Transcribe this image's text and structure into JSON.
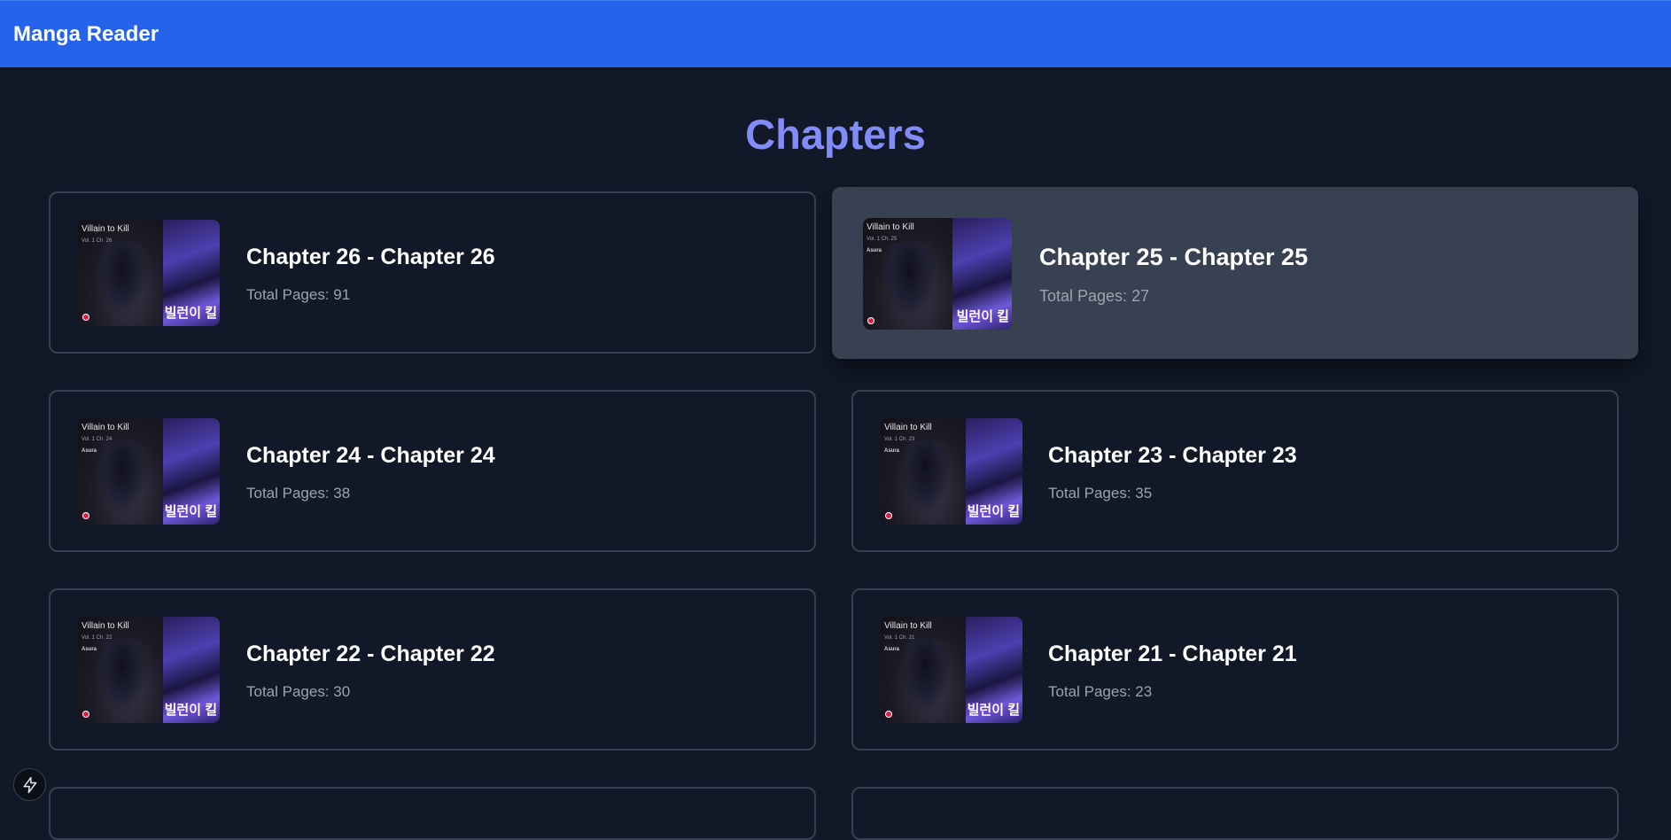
{
  "app": {
    "title": "Manga Reader"
  },
  "main": {
    "heading": "Chapters"
  },
  "thumbnail": {
    "title": "Villain to Kill",
    "author": "Asura",
    "korean": "빌런이 킬"
  },
  "chapters": [
    {
      "title": "Chapter 26 - Chapter 26",
      "pages": "Total Pages: 91",
      "vol": "Vol. 1 Ch. 26"
    },
    {
      "title": "Chapter 25 - Chapter 25",
      "pages": "Total Pages: 27",
      "vol": "Vol. 1 Ch. 25"
    },
    {
      "title": "Chapter 24 - Chapter 24",
      "pages": "Total Pages: 38",
      "vol": "Vol. 1 Ch. 24"
    },
    {
      "title": "Chapter 23 - Chapter 23",
      "pages": "Total Pages: 35",
      "vol": "Vol. 1 Ch. 23"
    },
    {
      "title": "Chapter 22 - Chapter 22",
      "pages": "Total Pages: 30",
      "vol": "Vol. 1 Ch. 22"
    },
    {
      "title": "Chapter 21 - Chapter 21",
      "pages": "Total Pages: 23",
      "vol": "Vol. 1 Ch. 21"
    }
  ],
  "colors": {
    "header": "#2563eb",
    "background": "#111827",
    "heading": "#818cf8",
    "card_border": "#374151",
    "card_hover": "#374151",
    "muted_text": "#9ca3af"
  },
  "icons": {
    "floating_button": "lightning-bolt-icon"
  }
}
